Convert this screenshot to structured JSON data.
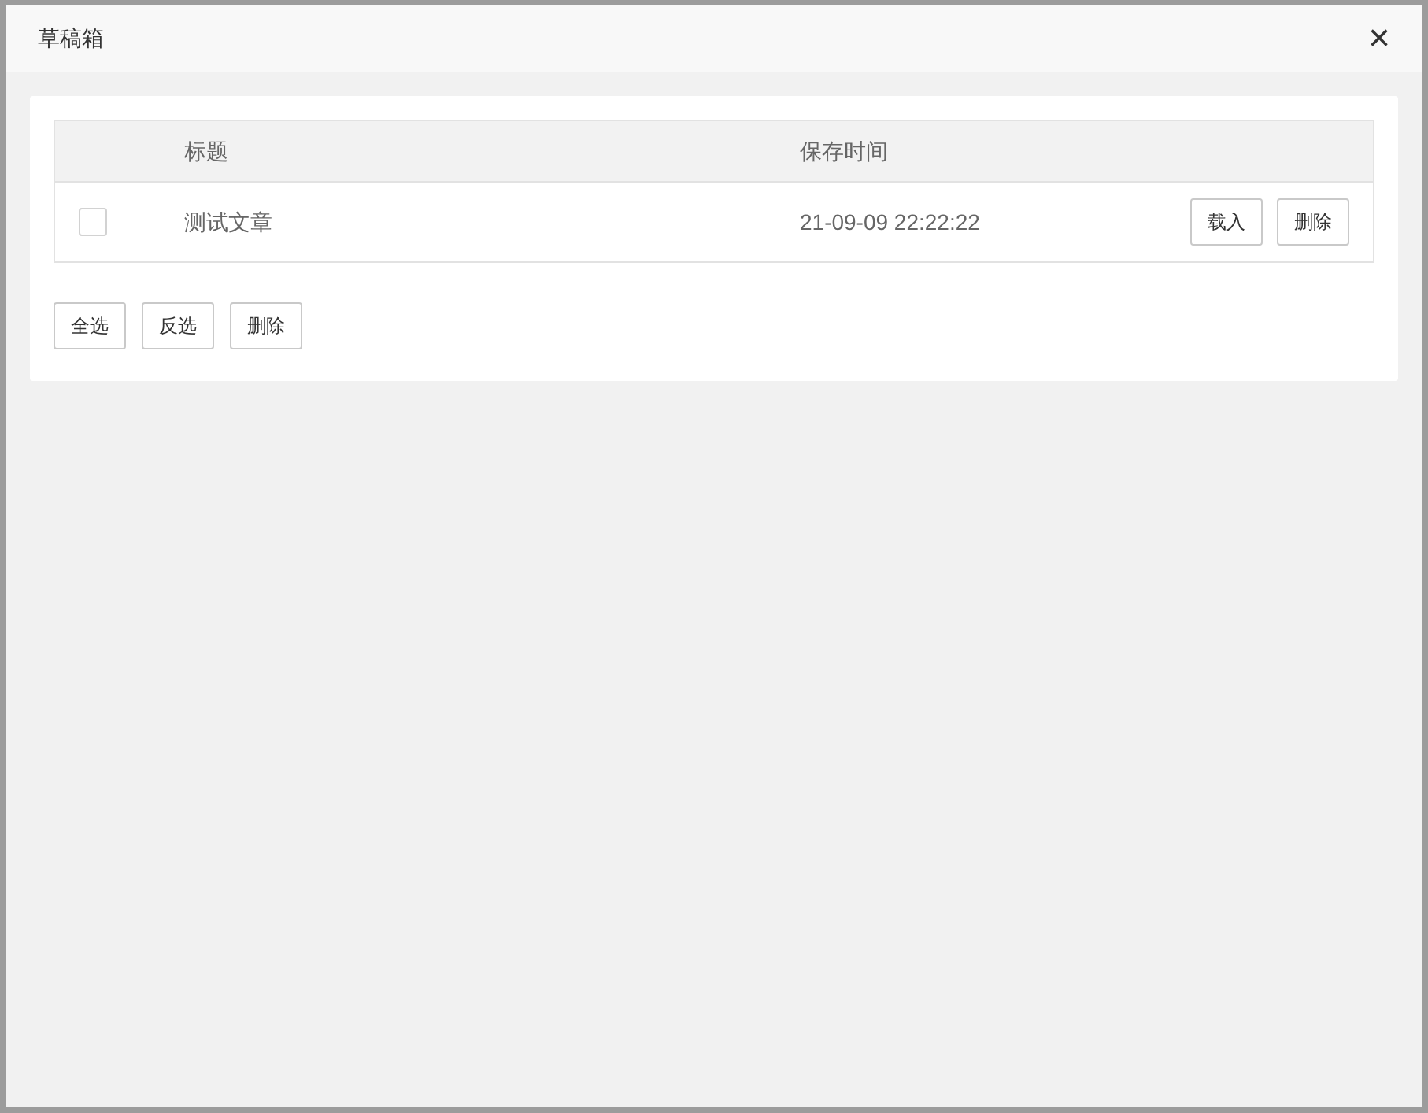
{
  "window": {
    "title": "草稿箱",
    "close": "×"
  },
  "table": {
    "columns": [
      "标题",
      "保存时间"
    ],
    "rows": [
      {
        "checked": false,
        "title": "测试文章",
        "time": "21-09-09 22:22:22",
        "actions": [
          "载入",
          "删除"
        ]
      }
    ]
  },
  "buttons": [
    "全选",
    "反选",
    "删除"
  ]
}
